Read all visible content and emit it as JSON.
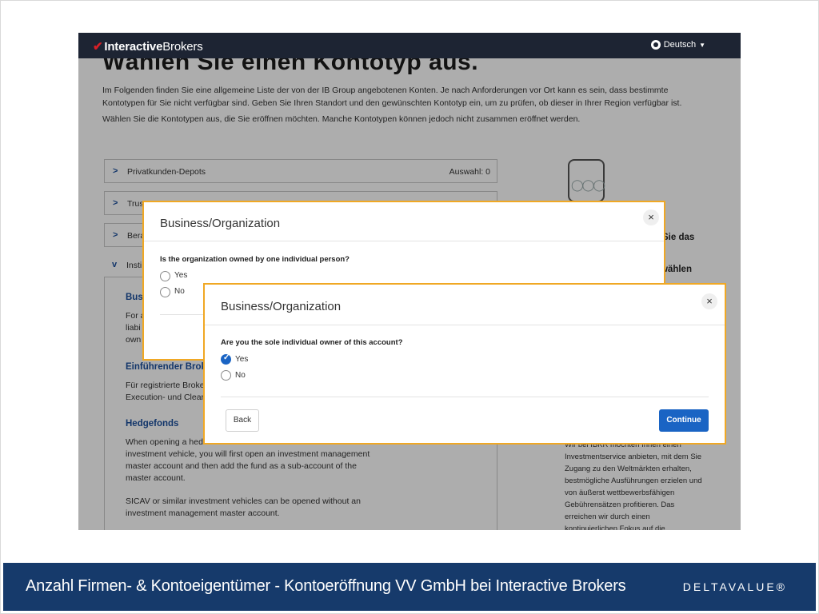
{
  "navbar": {
    "logo_mark": "✔",
    "logo_bold": "Interactive",
    "logo_rest": "Brokers",
    "language": "Deutsch"
  },
  "page": {
    "title": "Wählen Sie einen Kontotyp aus.",
    "intro_line1": "Im Folgenden finden Sie eine allgemeine Liste der von der IB Group angebotenen Konten. Je nach Anforderungen vor Ort kann es sein, dass bestimmte",
    "intro_line2": "Kontotypen für Sie nicht verfügbar sind. Geben Sie Ihren Standort und den gewünschten Kontotyp ein, um zu prüfen, ob dieser in Ihrer Region verfügbar ist.",
    "intro_line3": "Wählen Sie die Kontotypen aus, die Sie eröffnen möchten. Manche Kontotypen können jedoch nicht zusammen eröffnet werden.",
    "accordion": [
      {
        "label": "Privatkunden-Depots",
        "selection": "Auswahl: 0"
      },
      {
        "label": "Trus",
        "selection": ""
      },
      {
        "label": "Bera",
        "selection": ""
      },
      {
        "label": "Insti",
        "selection": ""
      }
    ],
    "inst_heading": "Bus",
    "inst_text": [
      "For a",
      "liabi",
      "own"
    ],
    "broker_heading": "Einführender Brok",
    "broker_text": [
      "Für registrierte Broke",
      "Execution- und Clear"
    ],
    "hedge_heading": "Hedgefonds",
    "hedge_text": [
      "When opening a hed",
      "investment vehicle, you will first open an investment management",
      "master account and then add the fund as a sub-account of the",
      "master account."
    ],
    "sicav_text": [
      "SICAV or similar investment vehicles can be opened without an",
      "investment management master account."
    ]
  },
  "right_panel": {
    "bold1": "Sie das",
    "bold2": "wählen",
    "text": [
      "Wir bei IBKR möchten Ihnen einen",
      "Investmentservice anbieten, mit dem Sie",
      "Zugang zu den Weltmärkten erhalten,",
      "bestmögliche Ausführungen erzielen und",
      "von äußerst wettbewerbsfähigen",
      "Gebührensätzen profitieren. Das",
      "erreichen wir durch einen",
      "kontinuierlichen Fokus auf die"
    ]
  },
  "modal1": {
    "title": "Business/Organization",
    "question": "Is the organization owned by one individual person?",
    "options": [
      "Yes",
      "No"
    ],
    "close": "×"
  },
  "modal2": {
    "title": "Business/Organization",
    "question": "Are you the sole individual owner of this account?",
    "options": [
      "Yes",
      "No"
    ],
    "selected": "Yes",
    "close": "×",
    "back": "Back",
    "continue": "Continue"
  },
  "footer": {
    "caption": "Anzahl Firmen- & Kontoeigentümer - Kontoeröffnung VV GmbH bei Interactive Brokers",
    "brand": "DELTAVALUE®"
  },
  "colors": {
    "navbar": "#1d2433",
    "accent_blue": "#1a64c4",
    "modal_border": "#f0a824",
    "footer": "#163a6b"
  }
}
